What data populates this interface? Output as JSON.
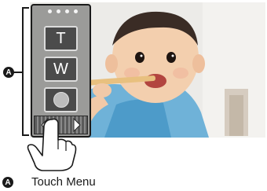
{
  "callout": {
    "label": "A"
  },
  "touch_menu": {
    "page_dots": 4,
    "buttons": [
      {
        "id": "tele",
        "label": "T"
      },
      {
        "id": "wide",
        "label": "W"
      },
      {
        "id": "record",
        "icon": "record-dot-icon"
      }
    ],
    "scroll_icons": [
      "scroll-left-arrow-icon",
      "scroll-right-arrow-icon"
    ]
  },
  "legend": {
    "badge": "A",
    "text": "Touch Menu"
  },
  "icons": [
    "finger-touch-icon",
    "record-dot-icon",
    "scroll-left-arrow-icon",
    "scroll-right-arrow-icon"
  ],
  "colors": {
    "panel": "#9b9b99",
    "button": "#4b4b4b",
    "outline": "#1a1a1a"
  }
}
